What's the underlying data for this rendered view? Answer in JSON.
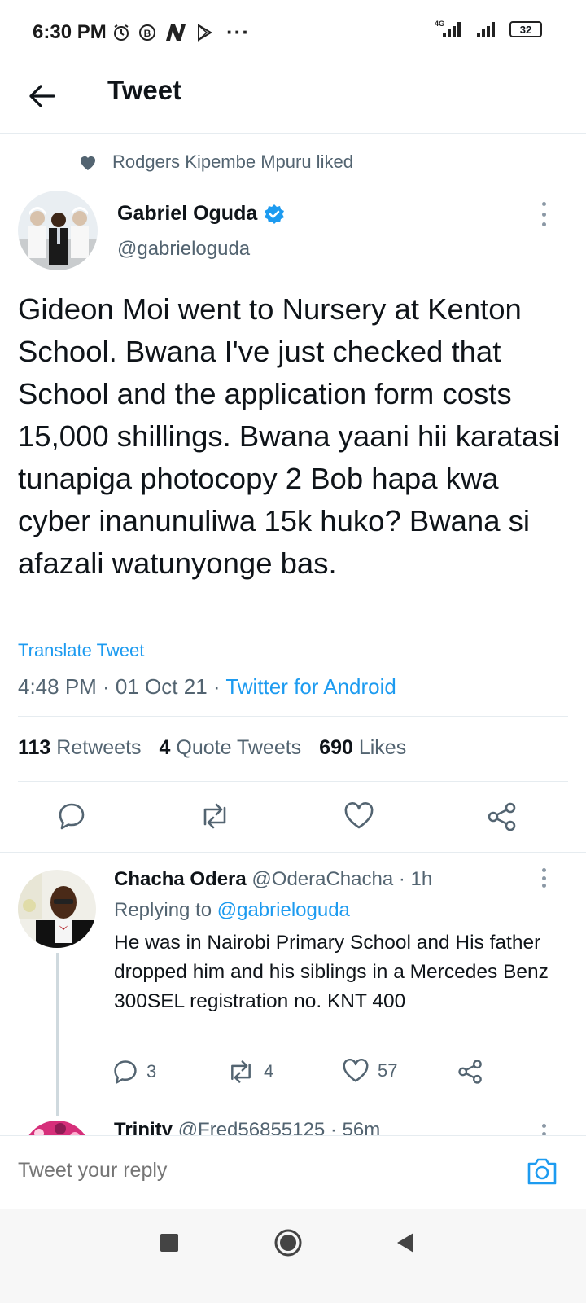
{
  "status_bar": {
    "time": "6:30 PM",
    "network": "4G",
    "battery": "32",
    "overflow": "···"
  },
  "app_bar": {
    "title": "Tweet"
  },
  "social_context": {
    "text": "Rodgers Kipembe Mpuru liked"
  },
  "tweet": {
    "author_name": "Gabriel Oguda",
    "author_handle": "@gabrieloguda",
    "verified": true,
    "text": "Gideon Moi went to Nursery at Kenton School. Bwana I've just checked that School and the application form costs 15,000 shillings. Bwana yaani hii karatasi tunapiga photocopy 2 Bob hapa kwa cyber inanunuliwa 15k huko? Bwana si afazali watunyonge bas.",
    "translate_label": "Translate Tweet",
    "timestamp": "4:48 PM · 01 Oct 21 · ",
    "source": "Twitter for Android",
    "stats": {
      "retweets_count": "113",
      "retweets_label": "Retweets",
      "quotes_count": "4",
      "quotes_label": "Quote Tweets",
      "likes_count": "690",
      "likes_label": "Likes"
    }
  },
  "replies": [
    {
      "name": "Chacha Odera",
      "handle": "@OderaChacha",
      "time": " · 1h",
      "replying_prefix": "Replying to ",
      "replying_to": "@gabrieloguda",
      "text": "He was in Nairobi Primary School and His father dropped him and his siblings in a Mercedes Benz 300SEL registration no. KNT 400",
      "reply_count": "3",
      "retweet_count": "4",
      "like_count": "57"
    },
    {
      "name": "Trinity",
      "handle": "@Fred56855125",
      "time": " · 56m"
    }
  ],
  "reply_bar": {
    "placeholder": "Tweet your reply"
  },
  "colors": {
    "accent": "#1d9bf0",
    "secondary_text": "#536471",
    "primary_text": "#0f1419"
  }
}
